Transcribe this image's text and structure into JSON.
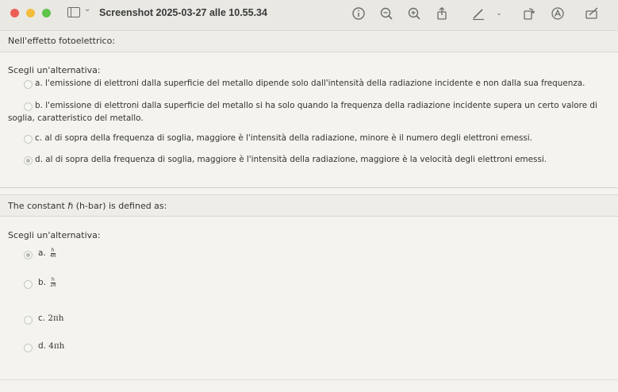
{
  "window": {
    "title": "Screenshot 2025-03-27 alle 10.55.34",
    "chevron": "⌄"
  },
  "toolbar": {
    "icons": [
      "info-icon",
      "zoom-out-icon",
      "zoom-in-icon",
      "share-icon",
      "markup-pen-icon",
      "chevron-down-icon",
      "rotate-icon",
      "highlight-icon",
      "annotate-icon"
    ]
  },
  "q1": {
    "title": "Nell'effetto fotoelettrico:",
    "choose": "Scegli un'alternativa:",
    "options": [
      {
        "label": "a. l'emissione di elettroni dalla superficie del metallo dipende solo dall'intensità della radiazione incidente e non dalla sua frequenza.",
        "selected": false
      },
      {
        "label": "b. l'emissione di elettroni dalla superficie del metallo si ha solo quando la frequenza della radiazione incidente supera un certo valore di",
        "label_cont": "soglia, caratteristico del metallo.",
        "selected": false
      },
      {
        "label": "c. al di sopra della frequenza di soglia, maggiore è l'intensità della radiazione, minore è il numero degli elettroni emessi.",
        "selected": false
      },
      {
        "label": "d. al di sopra della frequenza di soglia, maggiore è l'intensità della radiazione, maggiore è la velocità degli elettroni emessi.",
        "selected": true
      }
    ]
  },
  "q2": {
    "title": "The constant ℏ (h-bar) is defined as:",
    "choose": "Scegli un'alternativa:",
    "options": [
      {
        "prefix": "a.",
        "num": "h",
        "den": "4π",
        "selected": true
      },
      {
        "prefix": "b.",
        "num": "h",
        "den": "2π",
        "selected": false
      },
      {
        "prefix": "c.",
        "text": "2πh",
        "selected": false
      },
      {
        "prefix": "d.",
        "text": "4πh",
        "selected": false
      }
    ]
  }
}
